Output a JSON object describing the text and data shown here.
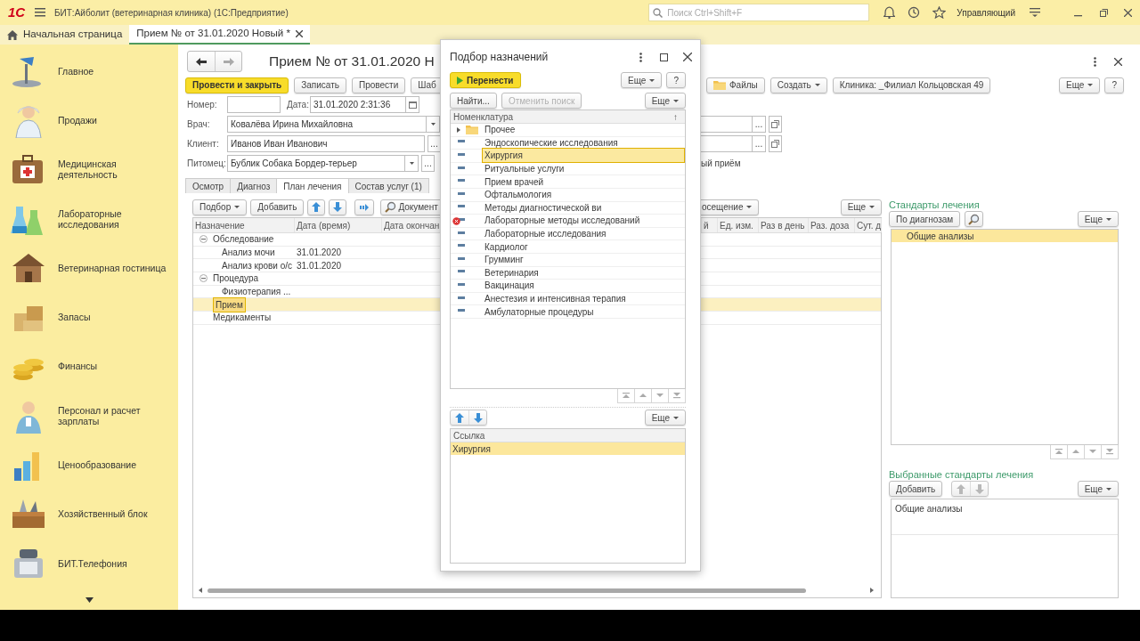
{
  "app": {
    "logo": "1С",
    "title": "БИТ:Айболит (ветеринарная клиника) (1С:Предприятие)",
    "search": {
      "placeholder": "Поиск Ctrl+Shift+F"
    },
    "user": "Управляющий"
  },
  "open_tabs": [
    {
      "label": "Начальная страница",
      "kind": "home",
      "selected": false
    },
    {
      "label": "Прием №  от 31.01.2020 Новый *",
      "kind": "document",
      "selected": true
    }
  ],
  "sections": [
    {
      "label": "Главное"
    },
    {
      "label": "Продажи"
    },
    {
      "label": "Медицинская деятельность"
    },
    {
      "label": "Лабораторные исследования"
    },
    {
      "label": "Ветеринарная гостиница"
    },
    {
      "label": "Запасы"
    },
    {
      "label": "Финансы"
    },
    {
      "label": "Персонал и расчет зарплаты"
    },
    {
      "label": "Ценообразование"
    },
    {
      "label": "Хозяйственный блок"
    },
    {
      "label": "БИТ.Телефония"
    }
  ],
  "form": {
    "title": "Прием №  от 31.01.2020 Н",
    "commands": [
      {
        "label": "Провести и закрыть",
        "kind": "primary"
      },
      {
        "label": "Записать",
        "kind": "plain"
      },
      {
        "label": "Провести",
        "kind": "plain"
      },
      {
        "label": "Шаб",
        "kind": "plain"
      }
    ],
    "commands_right": [
      {
        "label": "Файлы",
        "kind": "files"
      },
      {
        "label": "Создать",
        "kind": "dropdown"
      },
      {
        "label": "Клиника: _Филиал Кольцовская 49",
        "kind": "plain"
      }
    ],
    "more": "Еще",
    "help": "?",
    "number": {
      "label": "Номер:"
    },
    "date": {
      "label": "Дата:",
      "value": "31.01.2020  2:31:36"
    },
    "doctor": {
      "label": "Врач:",
      "value": "Ковалёва Ирина Михайловна",
      "choose_right": "..."
    },
    "client": {
      "label": "Клиент:",
      "value": "Иванов Иван Иванович",
      "choose": "...",
      "choose_right": "..."
    },
    "pet": {
      "label": "Питомец:",
      "value": "Бублик Собака Бордер-терьер",
      "choose": "..."
    },
    "visit_fragment": "ый приём",
    "tabs": [
      {
        "label": "Осмотр",
        "selected": false
      },
      {
        "label": "Диагноз",
        "selected": false
      },
      {
        "label": "План лечения",
        "selected": true
      },
      {
        "label": "Состав услуг (1)",
        "selected": false
      }
    ],
    "table_toolbar": [
      {
        "label": "Подбор",
        "kind": "dropdown"
      },
      {
        "label": "Добавить",
        "kind": "plain"
      },
      {
        "kind": "up"
      },
      {
        "kind": "down"
      },
      {
        "kind": "move"
      },
      {
        "label": "Документ",
        "kind": "search"
      }
    ],
    "table_toolbar_right": [
      {
        "label": "осещение",
        "kind": "dropdown"
      },
      {
        "label": "Еще",
        "kind": "dropdown"
      }
    ],
    "table": {
      "columns": [
        {
          "label": "Назначение"
        },
        {
          "label": "Дата (время)"
        },
        {
          "label": "Дата окончан"
        },
        {
          "label": "й"
        },
        {
          "label": "Ед. изм."
        },
        {
          "label": "Раз в день"
        },
        {
          "label": "Раз. доза"
        },
        {
          "label": "Сут. д"
        }
      ],
      "rows": [
        {
          "name": "Обследование",
          "expanded": true,
          "selected": false,
          "children": [
            {
              "name": "Анализ мочи",
              "date": "31.01.2020",
              "selected": false
            },
            {
              "name": "Анализ крови о/с",
              "date": "31.01.2020",
              "selected": false
            }
          ]
        },
        {
          "name": "Процедура",
          "expanded": true,
          "selected": false,
          "children": [
            {
              "name": "Физиотерапия ...",
              "selected": false
            }
          ]
        },
        {
          "name": "Прием",
          "selected": true
        },
        {
          "name": "Медикаменты",
          "selected": false
        }
      ]
    }
  },
  "standards": {
    "title": "Стандарты лечения",
    "by_diagnosis": "По диагнозам",
    "more": "Еще",
    "items": [
      {
        "name": "Общие анализы",
        "selected": true
      }
    ]
  },
  "chosen_standards": {
    "title": "Выбранные стандарты лечения",
    "add": "Добавить",
    "arrows": [
      {
        "kind": "up",
        "disabled": true
      },
      {
        "kind": "down",
        "disabled": true
      }
    ],
    "more": "Еще",
    "items": [
      {
        "name": "Общие анализы"
      }
    ]
  },
  "dialog": {
    "title": "Подбор назначений",
    "transfer": "Перенести",
    "more": "Еще",
    "help": "?",
    "find": {
      "label": "Найти...",
      "disabled": false
    },
    "cancel_find": {
      "label": "Отменить поиск",
      "disabled": true
    },
    "more2": "Еще",
    "tree_header": "Номенклатура",
    "sort_mark": "↑",
    "items": [
      {
        "name": "Прочее",
        "kind": "folder",
        "expanded": false,
        "selected": false,
        "deleted": false
      },
      {
        "name": "Эндоскопические исследования",
        "kind": "item",
        "selected": false,
        "deleted": false
      },
      {
        "name": "Хирургия",
        "kind": "item",
        "selected": true,
        "deleted": false
      },
      {
        "name": "Ритуальные услуги",
        "kind": "item",
        "selected": false,
        "deleted": false
      },
      {
        "name": "Прием врачей",
        "kind": "item",
        "selected": false,
        "deleted": false
      },
      {
        "name": "Офтальмология",
        "kind": "item",
        "selected": false,
        "deleted": false
      },
      {
        "name": "Методы диагностической ви",
        "kind": "item",
        "selected": false,
        "deleted": false
      },
      {
        "name": "Лабораторные методы исследований",
        "kind": "item",
        "selected": false,
        "deleted": true
      },
      {
        "name": "Лабораторные исследования",
        "kind": "item",
        "selected": false,
        "deleted": false
      },
      {
        "name": "Кардиолог",
        "kind": "item",
        "selected": false,
        "deleted": false
      },
      {
        "name": "Грумминг",
        "kind": "item",
        "selected": false,
        "deleted": false
      },
      {
        "name": "Ветеринария",
        "kind": "item",
        "selected": false,
        "deleted": false
      },
      {
        "name": "Вакцинация",
        "kind": "item",
        "selected": false,
        "deleted": false
      },
      {
        "name": "Анестезия и интенсивная терапия",
        "kind": "item",
        "selected": false,
        "deleted": false
      },
      {
        "name": "Амбулаторные процедуры",
        "kind": "item",
        "selected": false,
        "deleted": false
      }
    ],
    "arrows": [
      {
        "kind": "up",
        "disabled": false
      },
      {
        "kind": "down",
        "disabled": false
      }
    ],
    "more3": "Еще",
    "picked_header": "Ссылка",
    "picked": [
      {
        "name": "Хирургия",
        "selected": true
      }
    ]
  }
}
